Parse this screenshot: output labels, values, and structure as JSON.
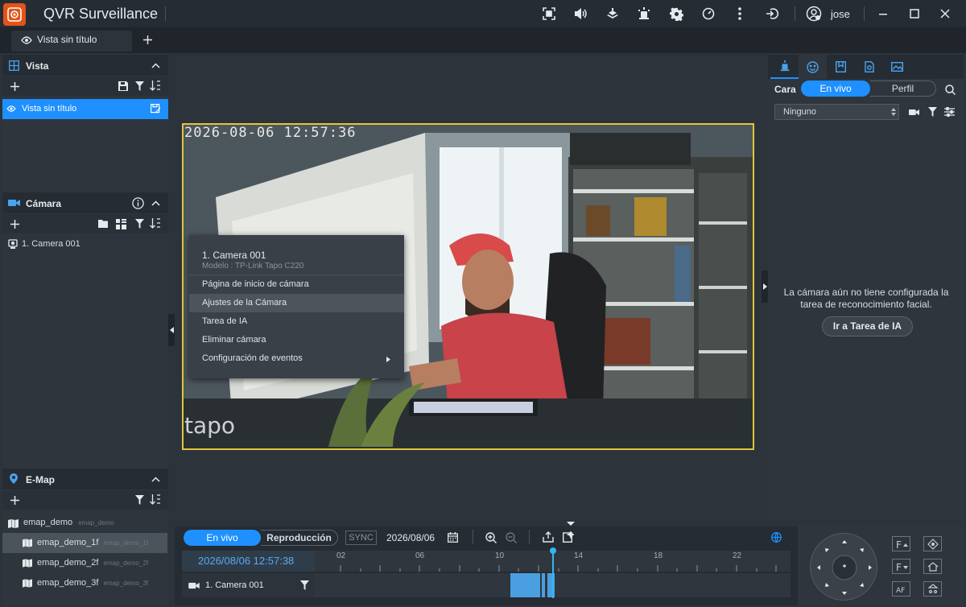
{
  "app": {
    "title": "QVR Surveillance",
    "user": "jose"
  },
  "tabs": [
    {
      "label": "Vista sin título"
    }
  ],
  "sidebar": {
    "view": {
      "title": "Vista",
      "items": [
        {
          "label": "Vista sin título"
        }
      ]
    },
    "camera": {
      "title": "Cámara",
      "items": [
        {
          "label": "1. Camera 001"
        }
      ]
    },
    "emap": {
      "title": "E-Map",
      "items": [
        {
          "label": "emap_demo",
          "sub": "emap_demo"
        },
        {
          "label": "emap_demo_1f",
          "sub": "emap_demo_1f"
        },
        {
          "label": "emap_demo_2f",
          "sub": "emap_demo_2f"
        },
        {
          "label": "emap_demo_3f",
          "sub": "emap_demo_3f"
        }
      ]
    }
  },
  "video": {
    "osd": "2026-08-06  12:57:36",
    "brand": "tapo"
  },
  "context_menu": {
    "title": "1. Camera 001",
    "subtitle": "Modelo : TP-Link Tapo C220",
    "items": [
      "Página de inicio de cámara",
      "Ajustes de la Cámara",
      "Tarea de IA",
      "Eliminar cámara",
      "Configuración de eventos"
    ]
  },
  "face_panel": {
    "label": "Cara",
    "seg_live": "En vivo",
    "seg_profile": "Perfil",
    "select_value": "Ninguno",
    "message": "La cámara aún no tiene configurada la tarea de reconocimiento facial.",
    "button": "Ir a Tarea de IA"
  },
  "playback": {
    "seg_live": "En vivo",
    "seg_play": "Reproducción",
    "sync": "SYNC",
    "date": "2026/08/06",
    "timestamp": "2026/08/06 12:57:38",
    "camera": "1. Camera 001",
    "hours": [
      "02",
      "06",
      "10",
      "14",
      "18",
      "22"
    ]
  },
  "colors": {
    "accent": "#1e90ff",
    "highlight": "#e2c53b",
    "brand": "#e2541a",
    "recording": "#4a9fe0"
  }
}
